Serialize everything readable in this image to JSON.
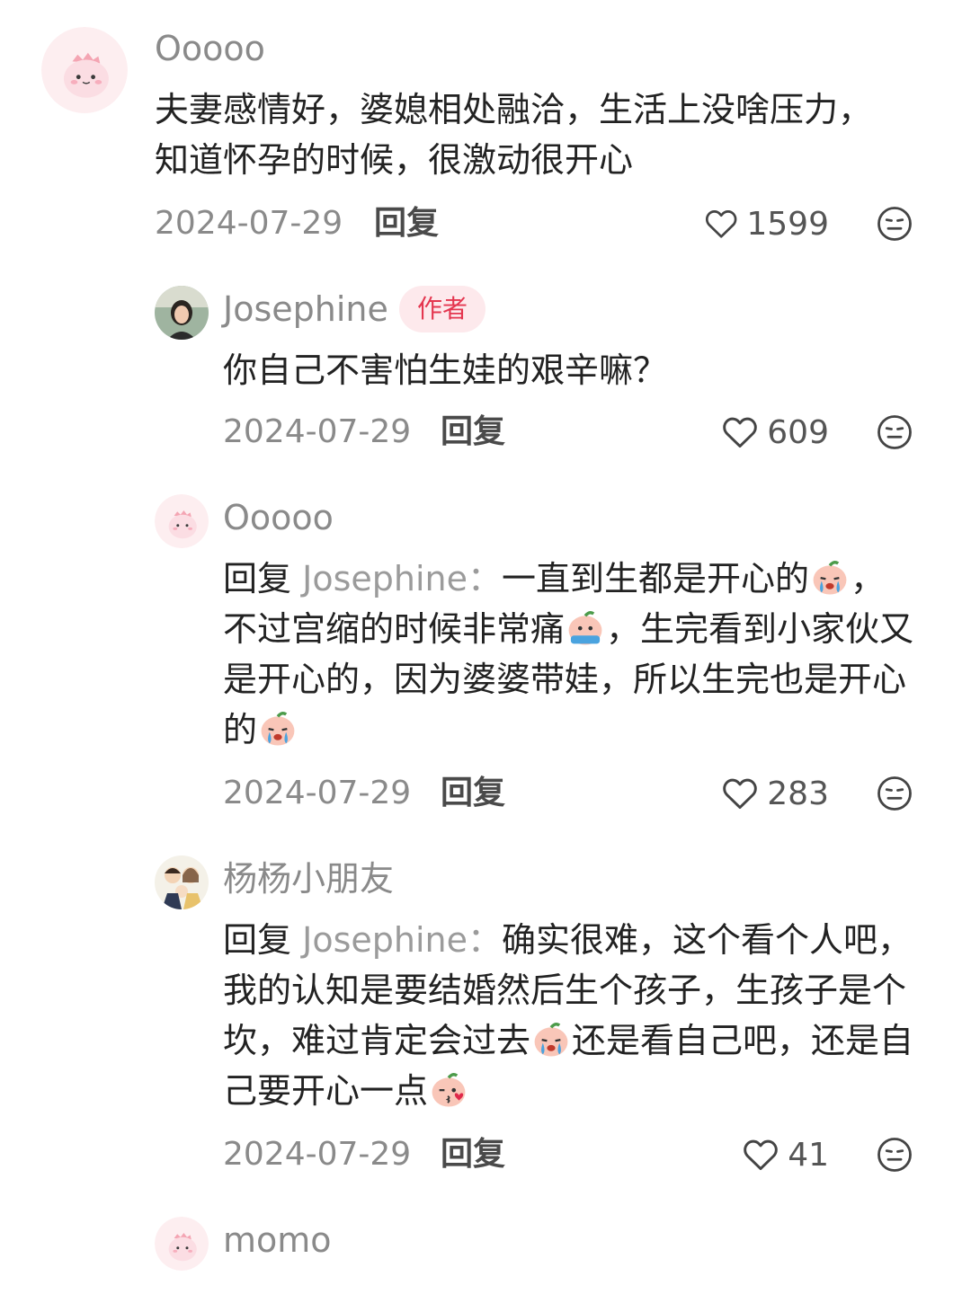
{
  "colors": {
    "muted_text": "#8a8a8a",
    "body_text": "#222222",
    "author_badge_bg": "#fde9ec",
    "author_badge_text": "#e4364f"
  },
  "comments": [
    {
      "user": "Ooooo",
      "avatar_icon": "pink-dino-avatar",
      "text": "夫妻感情好，婆媳相处融洽，生活上没啥压力，知道怀孕的时候，很激动很开心",
      "date": "2024-07-29",
      "reply_label": "回复",
      "likes": "1599"
    },
    {
      "user": "Josephine",
      "avatar_icon": "photo-avatar",
      "badge": "作者",
      "text": "你自己不害怕生娃的艰辛嘛？",
      "date": "2024-07-29",
      "reply_label": "回复",
      "likes": "609"
    },
    {
      "user": "Ooooo",
      "avatar_icon": "pink-dino-avatar",
      "reply_prefix": "回复",
      "reply_target": "Josephine：",
      "text_parts": [
        "一直到生都是开心的",
        "，不过宫缩的时候非常痛",
        "，生完看到小家伙又是开心的，因为婆婆带娃，所以生完也是开心的"
      ],
      "date": "2024-07-29",
      "reply_label": "回复",
      "likes": "283"
    },
    {
      "user": "杨杨小朋友",
      "avatar_icon": "cartoon-family-avatar",
      "reply_prefix": "回复",
      "reply_target": "Josephine：",
      "text_parts": [
        "确实很难，这个看个人吧，我的认知是要结婚然后生个孩子，生孩子是个坎，难过肯定会过去",
        "还是看自己吧，还是自己要开心一点"
      ],
      "date": "2024-07-29",
      "reply_label": "回复",
      "likes": "41"
    },
    {
      "user": "momo",
      "avatar_icon": "pink-dino-avatar"
    }
  ]
}
